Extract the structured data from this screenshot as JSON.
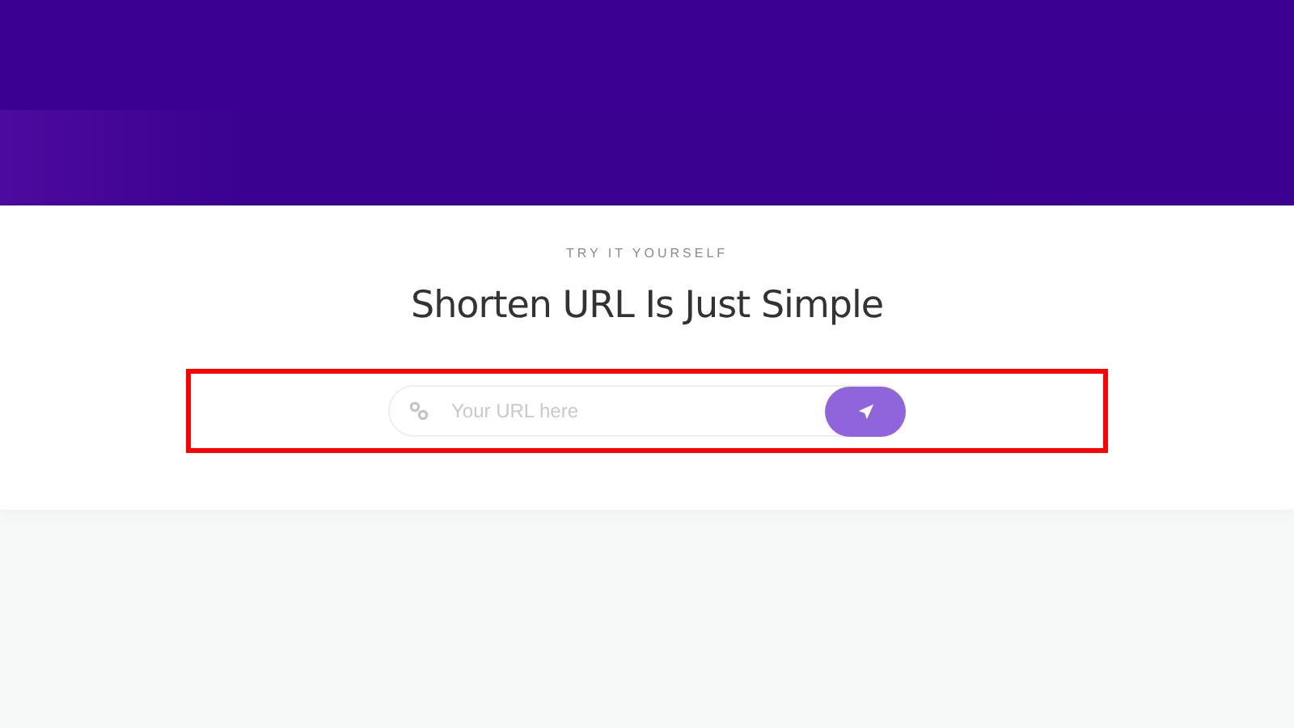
{
  "section": {
    "eyebrow": "TRY IT YOURSELF",
    "title": "Shorten URL Is Just Simple"
  },
  "url_form": {
    "placeholder": "Your URL here"
  }
}
